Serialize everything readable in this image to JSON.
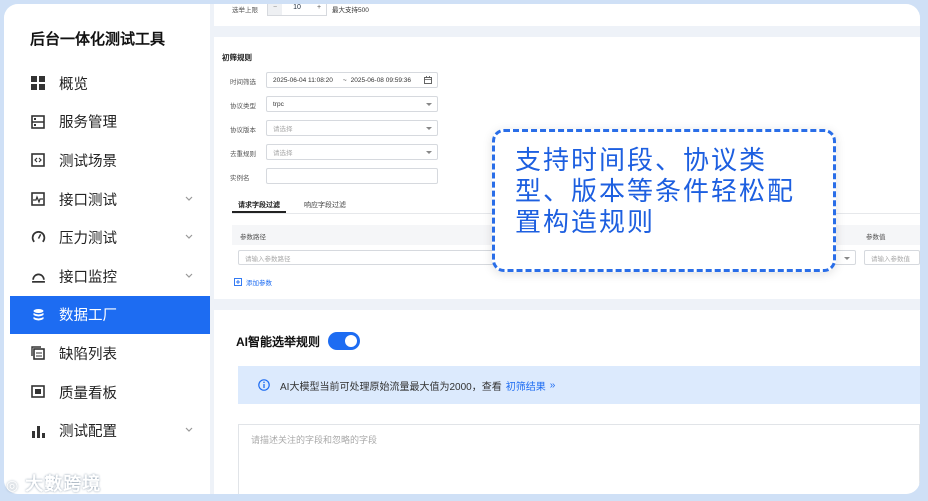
{
  "sidebar": {
    "brand": "后台一体化测试工具",
    "items": [
      {
        "label": "概览",
        "icon": "grid-icon",
        "chevron": false
      },
      {
        "label": "服务管理",
        "icon": "server-icon",
        "chevron": false
      },
      {
        "label": "测试场景",
        "icon": "code-icon",
        "chevron": false
      },
      {
        "label": "接口测试",
        "icon": "pulse-icon",
        "chevron": true
      },
      {
        "label": "压力测试",
        "icon": "gauge-icon",
        "chevron": true
      },
      {
        "label": "接口监控",
        "icon": "monitor-icon",
        "chevron": true
      },
      {
        "label": "数据工厂",
        "icon": "database-icon",
        "chevron": false,
        "active": true
      },
      {
        "label": "缺陷列表",
        "icon": "copy-icon",
        "chevron": false
      },
      {
        "label": "质量看板",
        "icon": "board-icon",
        "chevron": false
      },
      {
        "label": "测试配置",
        "icon": "bar-chart-icon",
        "chevron": true
      }
    ]
  },
  "top_card": {
    "select_label": "选举上限",
    "stepper_value": "10",
    "max_note": "最大支持500",
    "minus": "−",
    "plus": "+"
  },
  "rules": {
    "title": "初筛规则",
    "time_label": "时间筛选",
    "time_start": "2025-06-04 11:08:20",
    "time_sep": "~",
    "time_end": "2025-06-08 09:59:36",
    "protocol_label": "协议类型",
    "protocol_value": "trpc",
    "version_label": "协议版本",
    "version_placeholder": "请选择",
    "dedupe_label": "去重规则",
    "dedupe_placeholder": "请选择",
    "instance_label": "实例名",
    "tabs": [
      "请求字段过滤",
      "响应字段过滤"
    ],
    "col_param_path": "参数路径",
    "col_param_value": "参数值",
    "param_path_placeholder": "请输入参数路径",
    "param_value_placeholder": "请输入参数值",
    "add_param": "添加参数"
  },
  "ai": {
    "title": "AI智能选举规则",
    "toggle_on": true,
    "info_text": "AI大模型当前可处理原始流量最大值为2000，查看",
    "info_link": "初筛结果",
    "info_link_arrow": "»",
    "textarea_placeholder": "请描述关注的字段和忽略的字段"
  },
  "callout": {
    "text": "支持时间段、协议类型、版本等条件轻松配置构造规则"
  },
  "watermark": "大數跨境",
  "colors": {
    "accent": "#1d6cf2",
    "info_bg": "#dceafd",
    "callout_border": "#2a6ee8"
  }
}
